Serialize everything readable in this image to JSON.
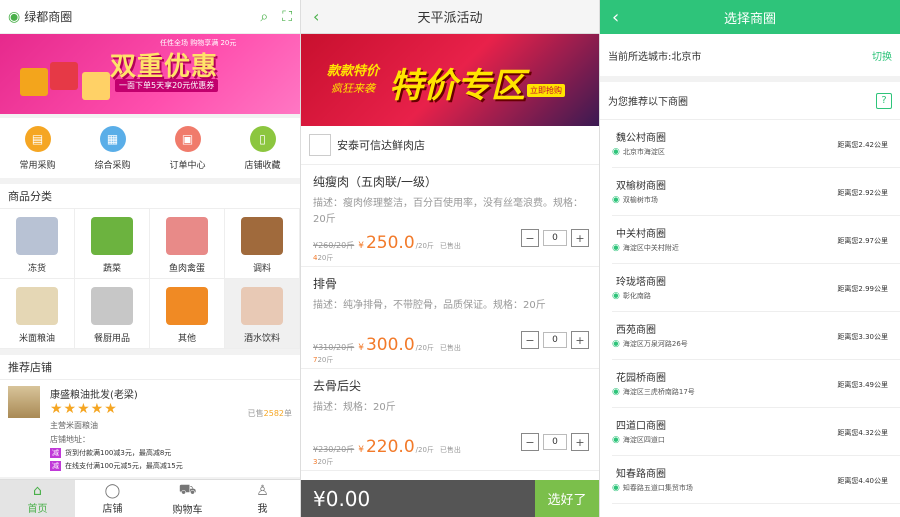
{
  "screen1": {
    "city": "绿都商圈",
    "banner": {
      "headline": "双重优惠",
      "tag": "任性全场 购物享满 20元",
      "sub": "一面下单5天享20元优惠券"
    },
    "quick": [
      {
        "label": "常用采购",
        "color": "#f5a623",
        "icon": "cart-icon"
      },
      {
        "label": "综合采购",
        "color": "#5aaee8",
        "icon": "grid-icon"
      },
      {
        "label": "订单中心",
        "color": "#f07b6b",
        "icon": "order-icon"
      },
      {
        "label": "店铺收藏",
        "color": "#8cc63f",
        "icon": "bookmark-icon"
      }
    ],
    "category_title": "商品分类",
    "categories": [
      {
        "label": "冻货",
        "color": "#b8c2d4"
      },
      {
        "label": "蔬菜",
        "color": "#6cb33f"
      },
      {
        "label": "鱼肉禽蛋",
        "color": "#e88a88"
      },
      {
        "label": "调料",
        "color": "#a06a3c"
      },
      {
        "label": "米面粮油",
        "color": "#e5d7b5"
      },
      {
        "label": "餐厨用品",
        "color": "#c7c7c7"
      },
      {
        "label": "其他",
        "color": "#f08a24"
      },
      {
        "label": "酒水饮料",
        "color": "#e8c9b5"
      }
    ],
    "recommend_title": "推荐店铺",
    "store": {
      "name": "康盛粮油批发(老梁)",
      "stars": "★★★★★",
      "sold_prefix": "已售",
      "sold_count": "2582",
      "sold_suffix": "单",
      "main": "主营米面粮油",
      "address": "店铺地址：",
      "promo_badge": "减",
      "promo1": "货到付款满100减3元，最高减8元",
      "promo2": "在线支付满100元减5元，最高减15元"
    },
    "tabs": [
      {
        "label": "首页",
        "icon": "home-icon"
      },
      {
        "label": "店铺",
        "icon": "store-icon"
      },
      {
        "label": "购物车",
        "icon": "cart-icon"
      },
      {
        "label": "我",
        "icon": "user-icon"
      }
    ]
  },
  "screen2": {
    "title": "天平派活动",
    "banner": {
      "headline": "特价专区",
      "line1": "款款特价",
      "line2": "疯狂来袭",
      "button": "立即抢购",
      "badge": "天平派"
    },
    "shop": "安泰可信达鲜肉店",
    "products": [
      {
        "name": "纯瘦肉（五肉联/一级）",
        "desc": "描述：瘦肉修理整洁，百分百使用率，没有丝毫浪费。规格：20斤",
        "old": "¥260/20斤",
        "yen": "¥",
        "price": "250.0",
        "unit": "/20斤",
        "sold": "已售出",
        "count_num": "4",
        "count_unit": "20斤",
        "qty": "0"
      },
      {
        "name": "排骨",
        "desc": "描述：纯净排骨，不带腔骨，品质保证。规格：20斤",
        "old": "¥310/20斤",
        "yen": "¥",
        "price": "300.0",
        "unit": "/20斤",
        "sold": "已售出",
        "count_num": "7",
        "count_unit": "20斤",
        "qty": "0"
      },
      {
        "name": "去骨后尖",
        "desc": "描述：规格：20斤",
        "old": "¥230/20斤",
        "yen": "¥",
        "price": "220.0",
        "unit": "/20斤",
        "sold": "已售出",
        "count_num": "3",
        "count_unit": "20斤",
        "qty": "0"
      }
    ],
    "total": "¥0.00",
    "confirm": "选好了"
  },
  "screen3": {
    "title": "选择商圈",
    "current_city": "当前所选城市:北京市",
    "switch": "切换",
    "recommend": "为您推荐以下商圈",
    "malls": [
      {
        "name": "魏公村商圈",
        "addr": "北京市海淀区",
        "dist": "距离您2.42公里"
      },
      {
        "name": "双榆树商圈",
        "addr": "双榆树市场",
        "dist": "距离您2.92公里"
      },
      {
        "name": "中关村商圈",
        "addr": "海淀区中关村附近",
        "dist": "距离您2.97公里"
      },
      {
        "name": "玲珑塔商圈",
        "addr": "彰化南路",
        "dist": "距离您2.99公里"
      },
      {
        "name": "西苑商圈",
        "addr": "海淀区万泉河路26号",
        "dist": "距离您3.30公里"
      },
      {
        "name": "花园桥商圈",
        "addr": "海淀区三虎桥南路17号",
        "dist": "距离您3.49公里"
      },
      {
        "name": "四道口商圈",
        "addr": "海淀区四道口",
        "dist": "距离您4.32公里"
      },
      {
        "name": "知春路商圈",
        "addr": "知春路五道口集贸市场",
        "dist": "距离您4.40公里"
      }
    ]
  }
}
